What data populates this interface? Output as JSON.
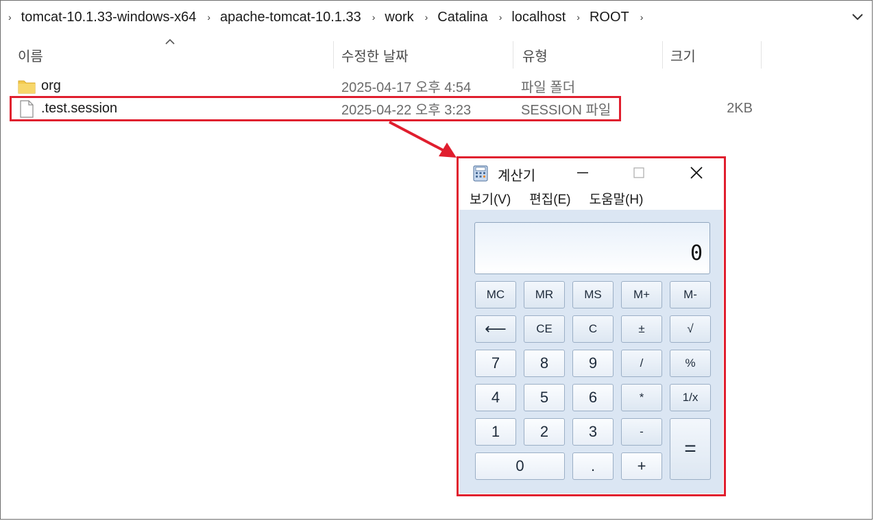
{
  "breadcrumb": {
    "items": [
      "tomcat-10.1.33-windows-x64",
      "apache-tomcat-10.1.33",
      "work",
      "Catalina",
      "localhost",
      "ROOT"
    ],
    "separator": "›"
  },
  "columns": {
    "name": "이름",
    "modified": "수정한 날짜",
    "type": "유형",
    "size": "크기"
  },
  "files": [
    {
      "name": "org",
      "modified": "2025-04-17 오후 4:54",
      "type": "파일 폴더",
      "size": "",
      "icon": "folder-icon"
    },
    {
      "name": ".test.session",
      "modified": "2025-04-22 오후 3:23",
      "type": "SESSION 파일",
      "size": "2KB",
      "icon": "file-icon"
    }
  ],
  "calculator": {
    "title": "계산기",
    "menu": [
      "보기(V)",
      "편집(E)",
      "도움말(H)"
    ],
    "display": "0",
    "keys": {
      "mc": "MC",
      "mr": "MR",
      "ms": "MS",
      "mplus": "M+",
      "mminus": "M-",
      "back": "⟵",
      "ce": "CE",
      "c": "C",
      "plusminus": "±",
      "sqrt": "√",
      "k7": "7",
      "k8": "8",
      "k9": "9",
      "div": "/",
      "pct": "%",
      "k4": "4",
      "k5": "5",
      "k6": "6",
      "mul": "*",
      "recip": "1/x",
      "k1": "1",
      "k2": "2",
      "k3": "3",
      "sub": "-",
      "eq": "=",
      "k0": "0",
      "dot": ".",
      "add": "+"
    }
  },
  "colors": {
    "highlight": "#e01e2e",
    "folder": "#f2c94c",
    "calc_bg": "#dbe6f3"
  }
}
